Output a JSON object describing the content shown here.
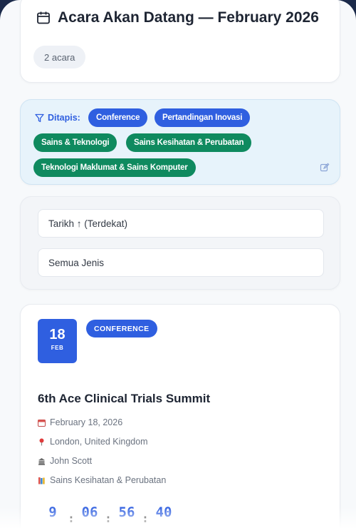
{
  "header": {
    "title": "Acara Akan Datang — February 2026",
    "count_label": "2 acara"
  },
  "filters": {
    "label": "Ditapis:",
    "chips": [
      {
        "label": "Conference",
        "color": "#2f5fe0"
      },
      {
        "label": "Pertandingan Inovasi",
        "color": "#2f5fe0"
      },
      {
        "label": "Sains & Teknologi",
        "color": "#0f8a5f"
      },
      {
        "label": "Sains Kesihatan & Perubatan",
        "color": "#0f8a5f"
      },
      {
        "label": "Teknologi Maklumat & Sains Komputer",
        "color": "#0f8a5f"
      }
    ],
    "edit_icon": "edit-icon"
  },
  "selects": {
    "sort": "Tarikh ↑ (Terdekat)",
    "type": "Semua Jenis"
  },
  "event": {
    "day": "18",
    "month": "FEB",
    "type_badge": "CONFERENCE",
    "title": "6th Ace Clinical Trials Summit",
    "date": "February 18, 2026",
    "location": "London, United Kingdom",
    "organizer": "John Scott",
    "category": "Sains Kesihatan & Perubatan",
    "countdown": {
      "days": "9",
      "hours": "06",
      "minutes": "56",
      "seconds": "40"
    }
  },
  "colors": {
    "accent": "#2f5fe0",
    "green": "#0f8a5f"
  }
}
